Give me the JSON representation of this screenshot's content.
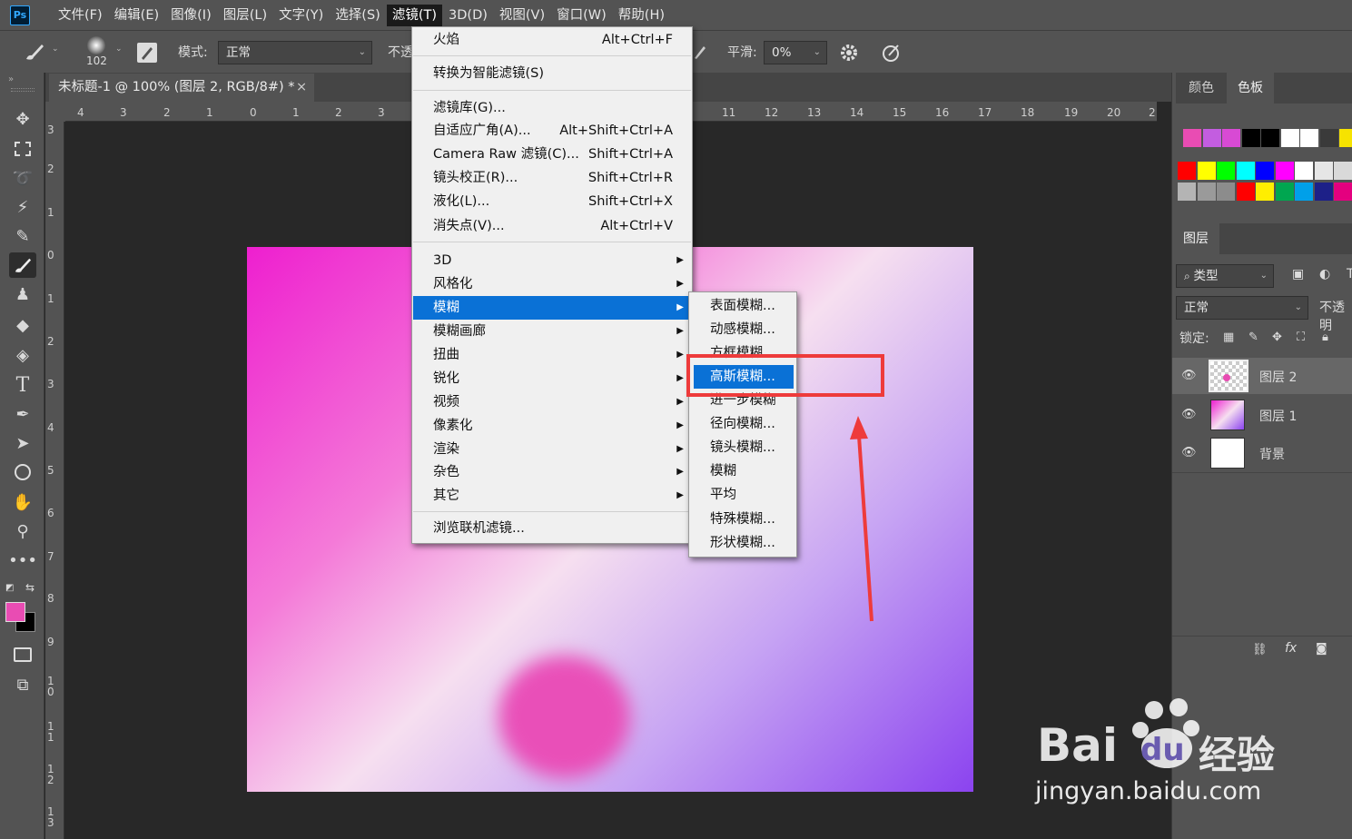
{
  "menubar": {
    "items": [
      "文件(F)",
      "编辑(E)",
      "图像(I)",
      "图层(L)",
      "文字(Y)",
      "选择(S)",
      "滤镜(T)",
      "3D(D)",
      "视图(V)",
      "窗口(W)",
      "帮助(H)"
    ],
    "active_index": 6,
    "logo": "Ps"
  },
  "options": {
    "brush_size": "102",
    "mode_label": "模式:",
    "mode_value": "正常",
    "opacity_label": "不透",
    "smooth_label": "平滑:",
    "smooth_value": "0%"
  },
  "document": {
    "tab_title": "未标题-1 @ 100% (图层 2, RGB/8#) *",
    "close": "×"
  },
  "rulers": {
    "h_labels": [
      "4",
      "3",
      "2",
      "1",
      "0",
      "1",
      "2",
      "3",
      "11",
      "12",
      "13",
      "14",
      "15",
      "16",
      "17",
      "18",
      "19",
      "20",
      "2"
    ],
    "v_labels": [
      "3",
      "2",
      "1",
      "0",
      "1",
      "2",
      "3",
      "4",
      "5",
      "6",
      "7",
      "8",
      "9",
      "1\n0",
      "1\n1",
      "1\n2",
      "1\n3"
    ]
  },
  "filter_menu": {
    "items": [
      {
        "label": "火焰",
        "shortcut": "Alt+Ctrl+F"
      },
      {
        "label": "转换为智能滤镜(S)",
        "shortcut": ""
      },
      {
        "label": "滤镜库(G)...",
        "shortcut": ""
      },
      {
        "label": "自适应广角(A)...",
        "shortcut": "Alt+Shift+Ctrl+A"
      },
      {
        "label": "Camera Raw 滤镜(C)...",
        "shortcut": "Shift+Ctrl+A"
      },
      {
        "label": "镜头校正(R)...",
        "shortcut": "Shift+Ctrl+R"
      },
      {
        "label": "液化(L)...",
        "shortcut": "Shift+Ctrl+X"
      },
      {
        "label": "消失点(V)...",
        "shortcut": "Alt+Ctrl+V"
      },
      {
        "label": "3D",
        "shortcut": ""
      },
      {
        "label": "风格化",
        "shortcut": ""
      },
      {
        "label": "模糊",
        "shortcut": ""
      },
      {
        "label": "模糊画廊",
        "shortcut": ""
      },
      {
        "label": "扭曲",
        "shortcut": ""
      },
      {
        "label": "锐化",
        "shortcut": ""
      },
      {
        "label": "视频",
        "shortcut": ""
      },
      {
        "label": "像素化",
        "shortcut": ""
      },
      {
        "label": "渲染",
        "shortcut": ""
      },
      {
        "label": "杂色",
        "shortcut": ""
      },
      {
        "label": "其它",
        "shortcut": ""
      },
      {
        "label": "浏览联机滤镜...",
        "shortcut": ""
      }
    ],
    "highlighted_index": 10
  },
  "blur_submenu": {
    "items": [
      "表面模糊...",
      "动感模糊...",
      "方框模糊...",
      "高斯模糊...",
      "进一步模糊",
      "径向模糊...",
      "镜头模糊...",
      "模糊",
      "平均",
      "特殊模糊...",
      "形状模糊..."
    ],
    "highlighted_index": 3
  },
  "right_panel": {
    "tabs_top": [
      "颜色",
      "色板"
    ],
    "active_top": 1,
    "layers_tab": "图层",
    "filter_kind": "类型",
    "blend_mode": "正常",
    "opacity_label": "不透明",
    "lock_label": "锁定:",
    "layers": [
      {
        "name": "图层 2",
        "selected": true
      },
      {
        "name": "图层 1",
        "selected": false
      },
      {
        "name": "背景",
        "selected": false
      }
    ],
    "swatches_row1": [
      "#e94cb3",
      "#c35de0",
      "#d84ad4",
      "#000000",
      "#000000",
      "#ffffff",
      "#ffffff",
      "#3a3a3a",
      "#f6e300"
    ],
    "swatches_row2": [
      "#ff0000",
      "#ffff00",
      "#00ff00",
      "#00ffff",
      "#0000ff",
      "#ff00ff",
      "#ffffff",
      "#e6e6e6",
      "#d9d9d9"
    ],
    "swatches_row3": [
      "#b4b4b4",
      "#9a9a9a",
      "#8c8c8c",
      "#ff0000",
      "#ffee00",
      "#00a650",
      "#00a0e9",
      "#1d2088",
      "#e4007f"
    ]
  },
  "colors": {
    "accent": "#0a71d6",
    "annotation": "#ee3b3b",
    "foreground": "#e94cb3",
    "background": "#000000"
  },
  "watermark": {
    "brand": "Bai",
    "brand2": "du",
    "suffix": "经验",
    "url": "jingyan.baidu.com"
  }
}
